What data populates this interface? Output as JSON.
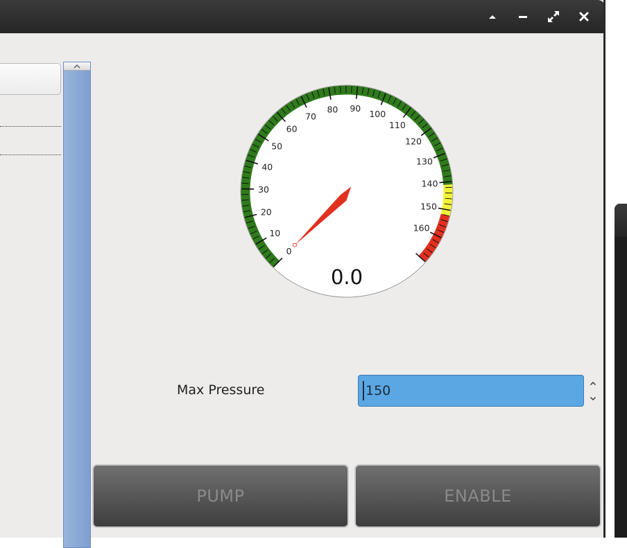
{
  "titlebar": {
    "buttons": [
      "shade",
      "minimize",
      "maximize",
      "close"
    ]
  },
  "gauge": {
    "value_display": "0.0",
    "needle_value": 0,
    "min": 0,
    "max": 170,
    "tick_labels": [
      "0",
      "10",
      "20",
      "30",
      "40",
      "50",
      "60",
      "70",
      "80",
      "90",
      "100",
      "110",
      "120",
      "130",
      "140",
      "150",
      "160"
    ],
    "zones": [
      {
        "from": 0,
        "to": 141,
        "color": "#2f7a1c"
      },
      {
        "from": 141,
        "to": 152,
        "color": "#f2f23a"
      },
      {
        "from": 152,
        "to": 170,
        "color": "#e2301f"
      }
    ],
    "needle_color": "#e2301f"
  },
  "form": {
    "max_pressure_label": "Max Pressure",
    "max_pressure_value": "150"
  },
  "buttons": {
    "pump_label": "PUMP",
    "enable_label": "ENABLE"
  }
}
